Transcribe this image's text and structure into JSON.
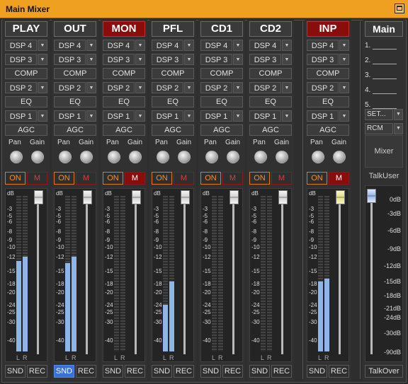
{
  "window": {
    "title": "Main Mixer"
  },
  "channels": [
    {
      "name": "PLAY",
      "highlight": false,
      "muted": false,
      "snd_active": false,
      "level_l": 0.58,
      "level_r": 0.61,
      "fader_db": 0
    },
    {
      "name": "OUT",
      "highlight": false,
      "muted": false,
      "snd_active": true,
      "level_l": 0.57,
      "level_r": 0.61,
      "fader_db": 0
    },
    {
      "name": "MON",
      "highlight": true,
      "muted": true,
      "snd_active": false,
      "level_l": 0,
      "level_r": 0,
      "fader_db": 0
    },
    {
      "name": "PFL",
      "highlight": false,
      "muted": false,
      "snd_active": false,
      "level_l": 0.3,
      "level_r": 0.45,
      "fader_db": 0
    },
    {
      "name": "CD1",
      "highlight": false,
      "muted": false,
      "snd_active": false,
      "level_l": 0,
      "level_r": 0,
      "fader_db": 0
    },
    {
      "name": "CD2",
      "highlight": false,
      "muted": false,
      "snd_active": false,
      "level_l": 0,
      "level_r": 0,
      "fader_db": 0
    },
    {
      "name": "INP",
      "highlight": true,
      "muted": true,
      "snd_active": false,
      "level_l": 0.45,
      "level_r": 0.47,
      "fader_db": 0
    }
  ],
  "labels": {
    "dsp4": "DSP 4",
    "dsp3": "DSP 3",
    "comp": "COMP",
    "dsp2": "DSP 2",
    "eq": "EQ",
    "dsp1": "DSP 1",
    "agc": "AGC",
    "pan": "Pan",
    "gain": "Gain",
    "on": "ON",
    "mute": "M",
    "l": "L",
    "r": "R",
    "snd": "SND",
    "rec": "REC"
  },
  "db_scale": [
    "dB",
    "-3",
    "-5",
    "-6",
    "-8",
    "-9",
    "-10",
    "-12",
    "-15",
    "-18",
    "-20",
    "-24",
    "-25",
    "-30",
    "-40"
  ],
  "main": {
    "name": "Main",
    "slots": [
      "1.",
      "2.",
      "3.",
      "4.",
      "5."
    ],
    "set_label": "SET...",
    "rcm_label": "RCM",
    "mixer_label": "Mixer",
    "talkuser_label": "TalkUser",
    "talkover_label": "TalkOver",
    "db_scale": [
      "0dB",
      "-3dB",
      "-6dB",
      "-9dB",
      "-12dB",
      "-15dB",
      "-18dB",
      "-21dB",
      "-24dB",
      "-30dB",
      "-90dB"
    ]
  },
  "colors": {
    "title_bar": "#f0a020",
    "meter": "#8fb4e8",
    "highlight_red": "#8a0d0d",
    "on_orange": "#e07818",
    "snd_active": "#3a6fd8"
  }
}
